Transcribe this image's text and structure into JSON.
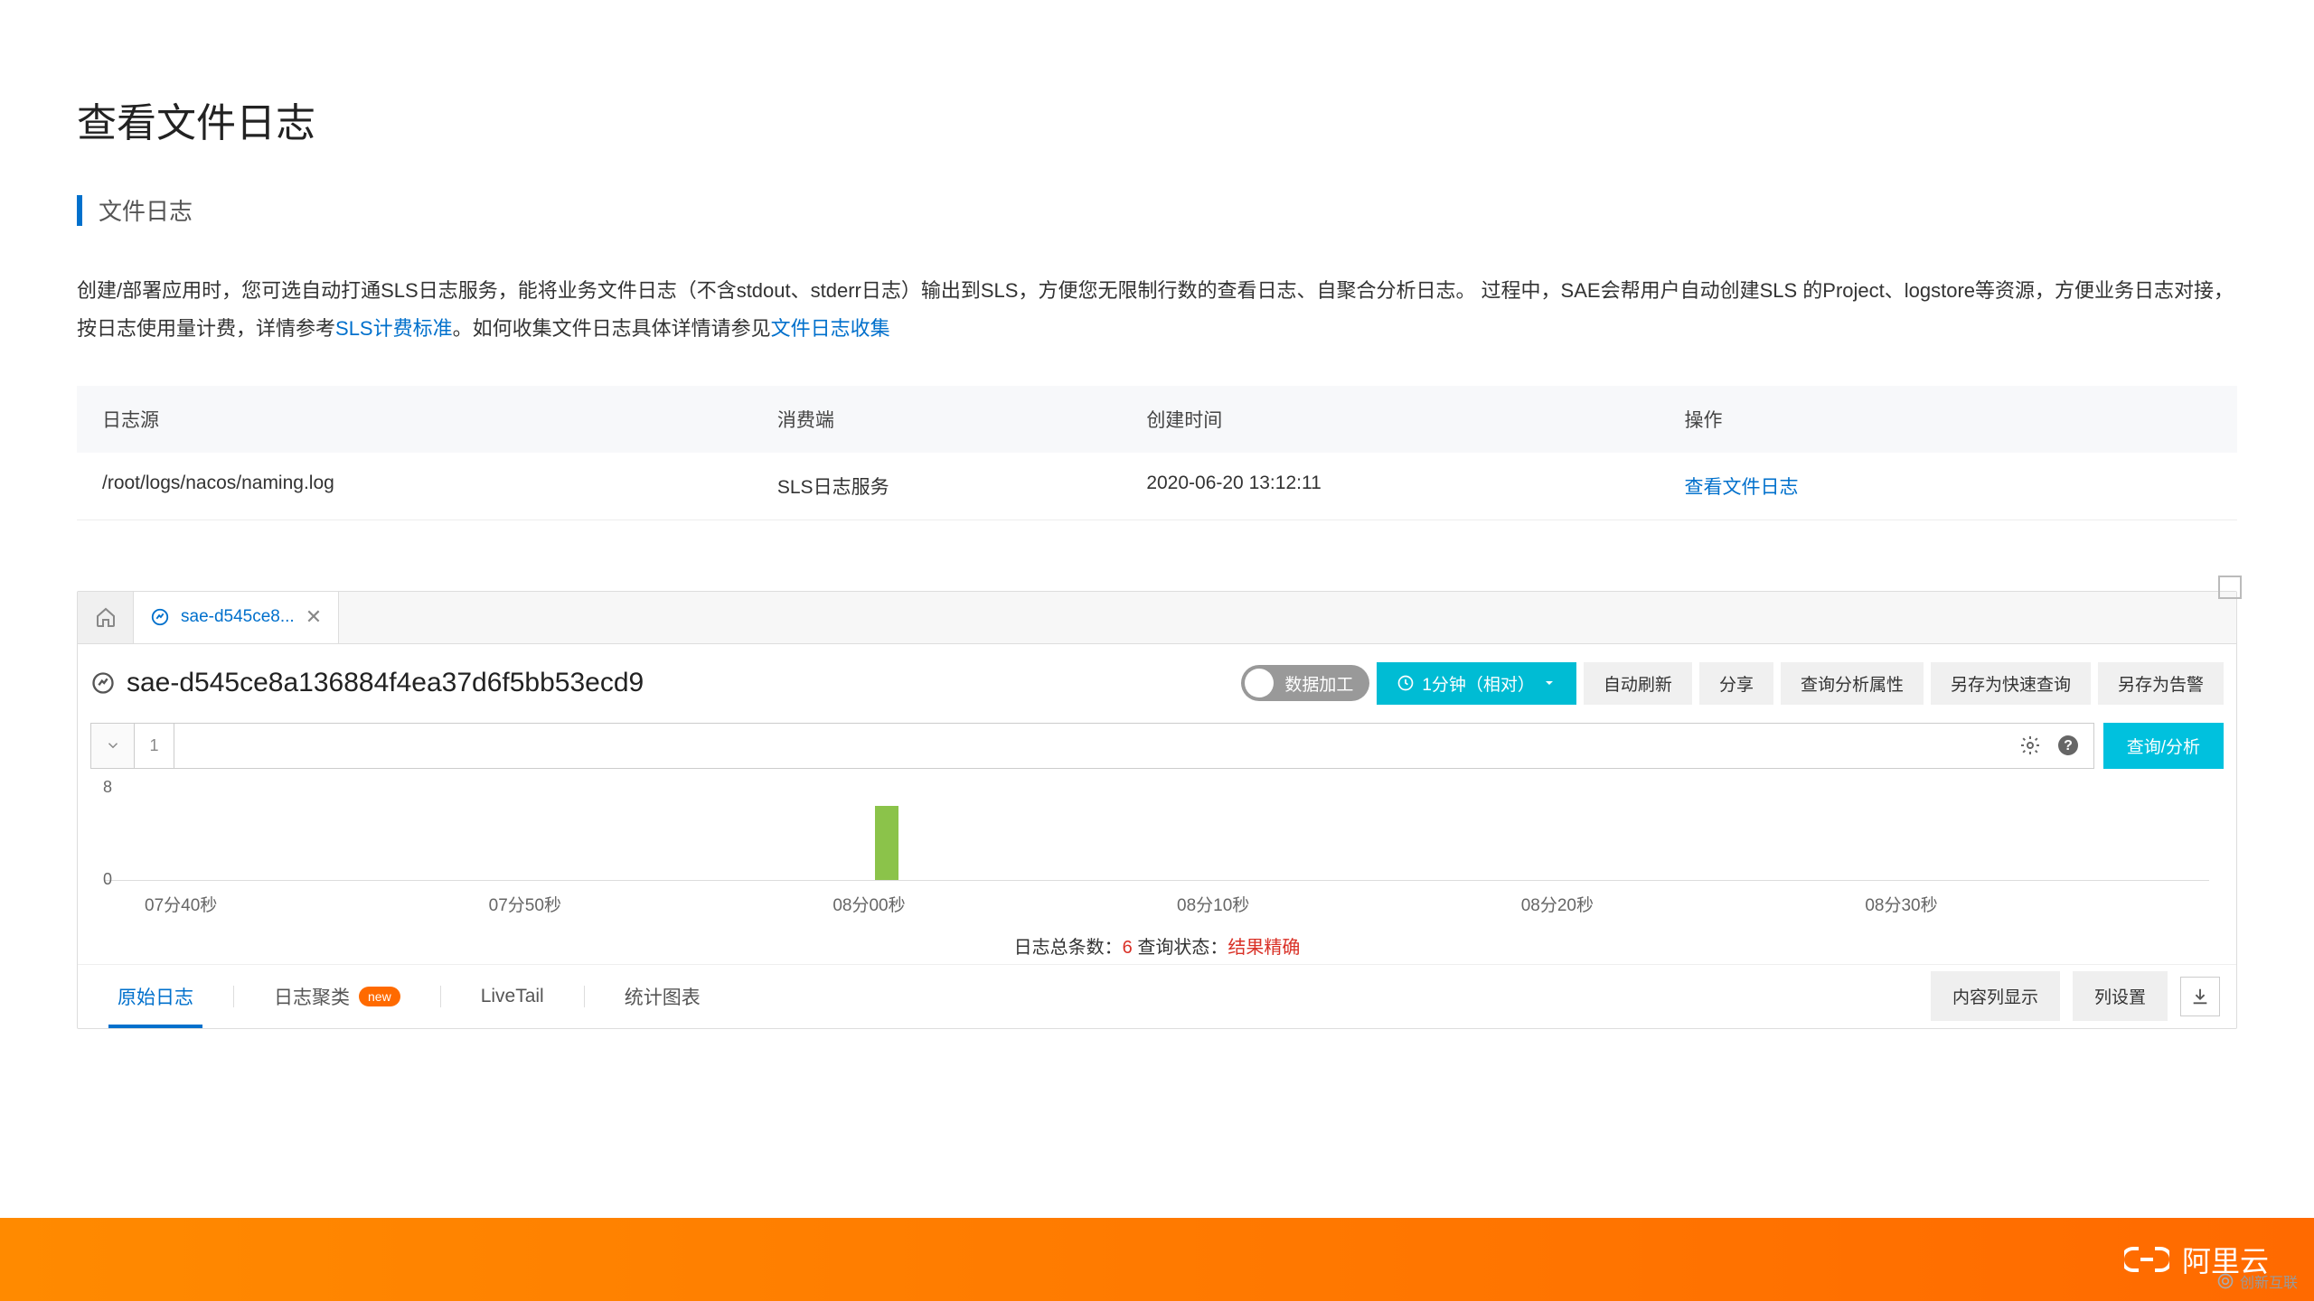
{
  "page_title": "查看文件日志",
  "section_title": "文件日志",
  "description": {
    "part1": "创建/部署应用时，您可选自动打通SLS日志服务，能将业务文件日志（不含stdout、stderr日志）输出到SLS，方便您无限制行数的查看日志、自聚合分析日志。 过程中，SAE会帮用户自动创建SLS 的Project、logstore等资源，方便业务日志对接，按日志使用量计费，详情参考",
    "link1": "SLS计费标准",
    "part2": "。如何收集文件日志具体详情请参见",
    "link2": "文件日志收集"
  },
  "table": {
    "headers": {
      "source": "日志源",
      "consumer": "消费端",
      "created": "创建时间",
      "action": "操作"
    },
    "rows": [
      {
        "source": "/root/logs/nacos/naming.log",
        "consumer": "SLS日志服务",
        "created": "2020-06-20 13:12:11",
        "action": "查看文件日志"
      }
    ]
  },
  "sls": {
    "tab_label": "sae-d545ce8...",
    "name": "sae-d545ce8a136884f4ea37d6f5bb53ecd9",
    "toggle_label": "数据加工",
    "time_button": "1分钟（相对）",
    "buttons": {
      "auto_refresh": "自动刷新",
      "share": "分享",
      "query_attr": "查询分析属性",
      "save_quick": "另存为快速查询",
      "save_alert": "另存为告警"
    },
    "query_num": "1",
    "query_btn": "查询/分析",
    "status": {
      "total_label": "日志总条数：",
      "total_value": "6",
      "state_label": " 查询状态：",
      "state_value": "结果精确"
    },
    "bottom_tabs": {
      "raw": "原始日志",
      "cluster": "日志聚类",
      "new_badge": "new",
      "livetail": "LiveTail",
      "stats": "统计图表"
    },
    "bottom_buttons": {
      "content_col": "内容列显示",
      "col_settings": "列设置"
    }
  },
  "chart_data": {
    "type": "bar",
    "categories": [
      "07分40秒",
      "07分50秒",
      "08分00秒",
      "08分10秒",
      "08分20秒",
      "08分30秒"
    ],
    "values": [
      0,
      0,
      6,
      0,
      0,
      0
    ],
    "ylim": [
      0,
      8
    ],
    "y_ticks": [
      0,
      8
    ],
    "xlabel": "",
    "ylabel": ""
  },
  "footer_brand": "阿里云",
  "watermark": "创新互联"
}
